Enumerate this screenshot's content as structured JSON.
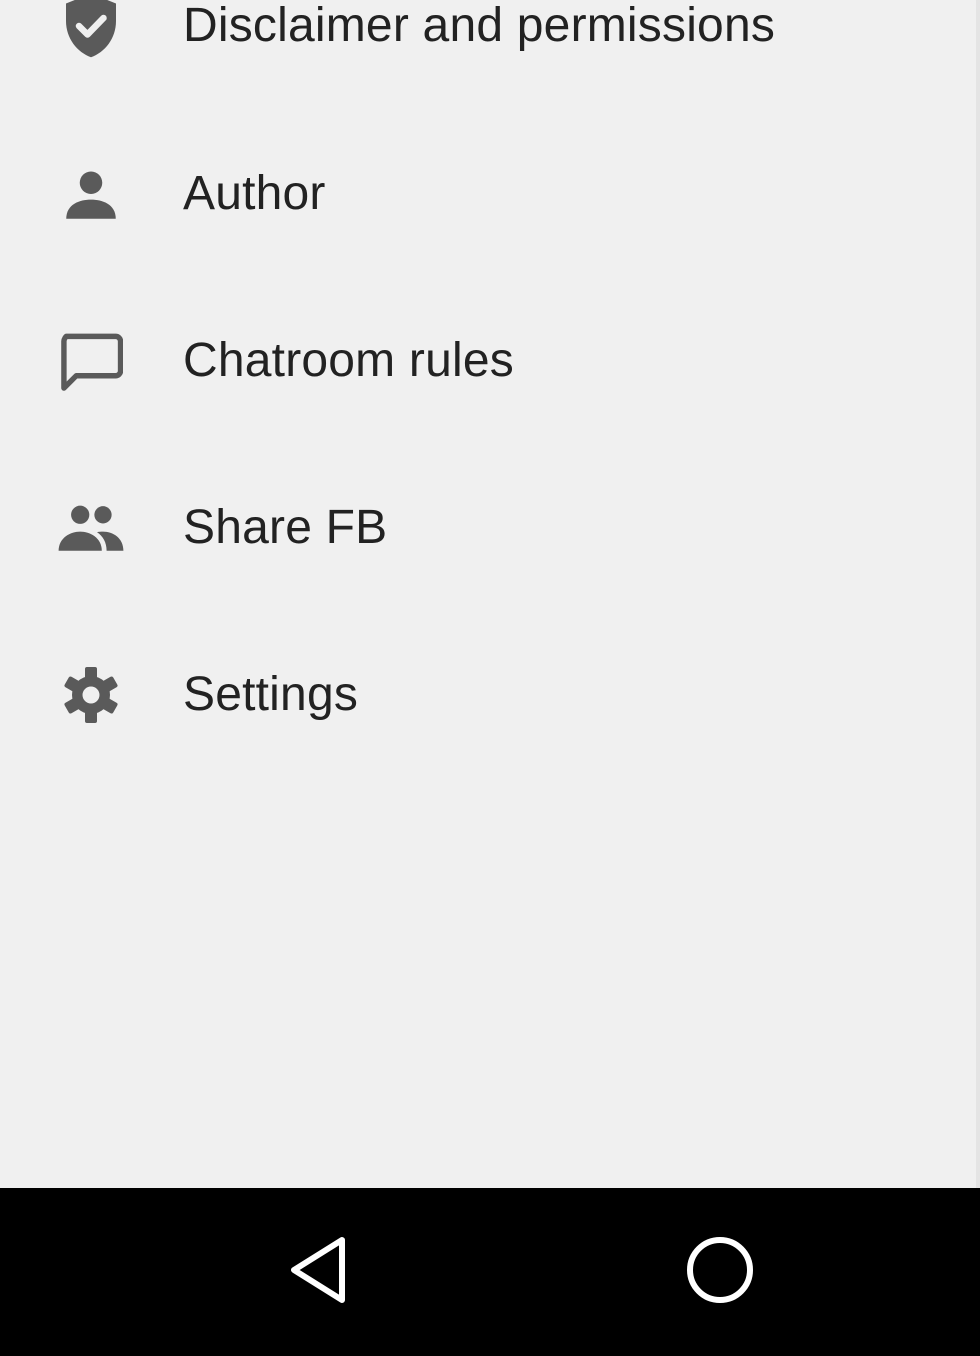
{
  "drawer": {
    "items": [
      {
        "label": "Disclaimer and permissions",
        "icon": "verified-shield-icon"
      },
      {
        "label": "Author",
        "icon": "person-icon"
      },
      {
        "label": "Chatroom rules",
        "icon": "chat-bubble-icon"
      },
      {
        "label": "Share FB",
        "icon": "people-icon"
      },
      {
        "label": "Settings",
        "icon": "gear-icon"
      }
    ]
  },
  "navbar": {
    "buttons": [
      {
        "icon": "back-triangle-icon"
      },
      {
        "icon": "home-circle-icon"
      }
    ]
  },
  "colors": {
    "background": "#f0f0f0",
    "icon": "#5a5a5a",
    "text": "#222222",
    "navbar": "#000000"
  }
}
